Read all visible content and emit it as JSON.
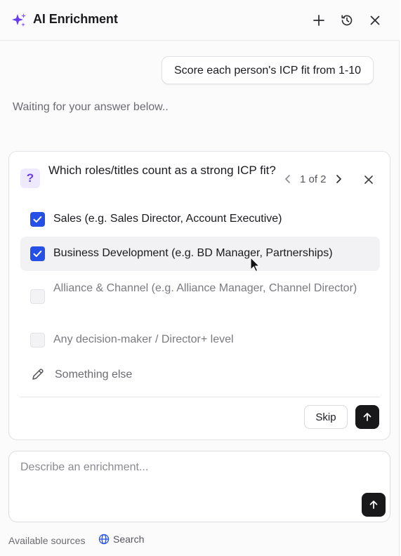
{
  "header": {
    "title": "AI Enrichment",
    "logo_icon": "sparkles-icon",
    "accent": "#6a3cf0",
    "actions": [
      "plus-icon",
      "history-icon",
      "close-icon"
    ]
  },
  "chat": {
    "user_message": "Score each person's ICP fit from 1-10",
    "status": "Waiting for your answer below.."
  },
  "question": {
    "badge": "?",
    "text": "Which roles/titles count as a strong ICP fit?",
    "pager": "1 of 2",
    "options": [
      {
        "label": "Sales (e.g. Sales Director, Account Executive)",
        "checked": true
      },
      {
        "label": "Business Development (e.g. BD Manager, Partnerships)",
        "checked": true
      },
      {
        "label": "Alliance & Channel (e.g. Alliance Manager, Channel Director)",
        "checked": false
      },
      {
        "label": "Any decision-maker / Director+ level",
        "checked": false
      }
    ],
    "other_label": "Something else",
    "skip_label": "Skip",
    "checkbox_color": "#2450e8"
  },
  "composer": {
    "placeholder": "Describe an enrichment..."
  },
  "footer": {
    "sources_label": "Available sources",
    "source": "Search"
  }
}
